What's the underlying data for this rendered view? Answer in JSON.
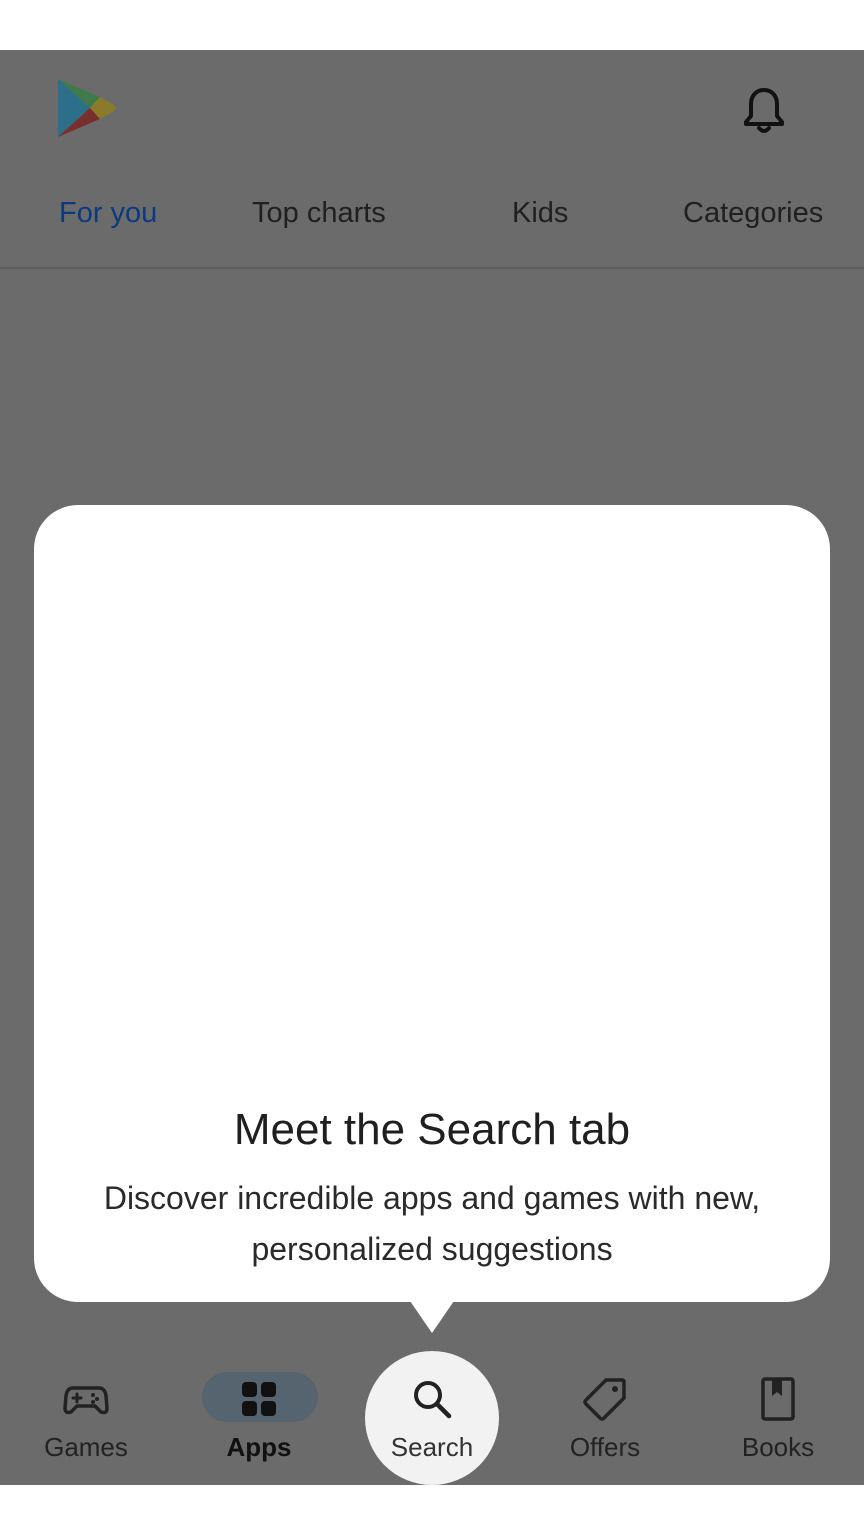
{
  "header": {
    "logo_icon": "google-play-logo-icon",
    "notification_icon": "bell-icon"
  },
  "tabs": [
    {
      "label": "For you",
      "active": true
    },
    {
      "label": "Top charts",
      "active": false
    },
    {
      "label": "Kids",
      "active": false
    },
    {
      "label": "Categories",
      "active": false
    }
  ],
  "popup": {
    "title": "Meet the Search tab",
    "description": "Discover incredible apps and games with new, personalized suggestions"
  },
  "bottom_nav": [
    {
      "label": "Games",
      "icon": "gamepad-icon"
    },
    {
      "label": "Apps",
      "icon": "apps-grid-icon",
      "selected": true
    },
    {
      "label": "Search",
      "icon": "search-icon",
      "highlighted": true
    },
    {
      "label": "Offers",
      "icon": "tag-icon"
    },
    {
      "label": "Books",
      "icon": "bookmark-book-icon"
    }
  ],
  "colors": {
    "overlay": "#6b6b6b",
    "active_tab": "#0b3a7e",
    "popup_bg": "#ffffff"
  }
}
